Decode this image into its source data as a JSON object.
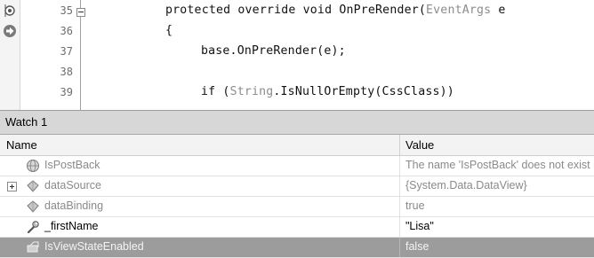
{
  "editor": {
    "lines": [
      {
        "number": "35",
        "code_parts": [
          "protected override void OnPreRender(",
          "EventArgs",
          " e"
        ],
        "gutter_icon": "breakpoint-icon"
      },
      {
        "number": "36",
        "code_parts": [
          "{"
        ],
        "gutter_icon": "current-statement-arrow-icon"
      },
      {
        "number": "37",
        "code_parts": [
          "base.OnPreRender(e);"
        ]
      },
      {
        "number": "38",
        "code_parts": [
          ""
        ]
      },
      {
        "number": "39",
        "code_parts": [
          "if (",
          "String",
          ".IsNullOrEmpty(CssClass))"
        ]
      }
    ]
  },
  "watch": {
    "title": "Watch 1",
    "columns": {
      "name": "Name",
      "value": "Value"
    },
    "rows": [
      {
        "name": "IsPostBack",
        "value": "The name 'IsPostBack' does not exist i",
        "icon": "error-globe-icon"
      },
      {
        "name": "dataSource",
        "value": "{System.Data.DataView}",
        "icon": "field-icon",
        "expandable": true
      },
      {
        "name": "dataBinding",
        "value": "true",
        "icon": "field-icon"
      },
      {
        "name": "_firstName",
        "value": "\"Lisa\"",
        "icon": "wrench-field-icon"
      },
      {
        "name": "IsViewStateEnabled",
        "value": "false",
        "icon": "property-icon",
        "selected": true
      }
    ]
  },
  "colors": {
    "selection": "#9c9c9c",
    "type_name": "#8c8c8c",
    "title_bar": "#d7d7d7"
  }
}
